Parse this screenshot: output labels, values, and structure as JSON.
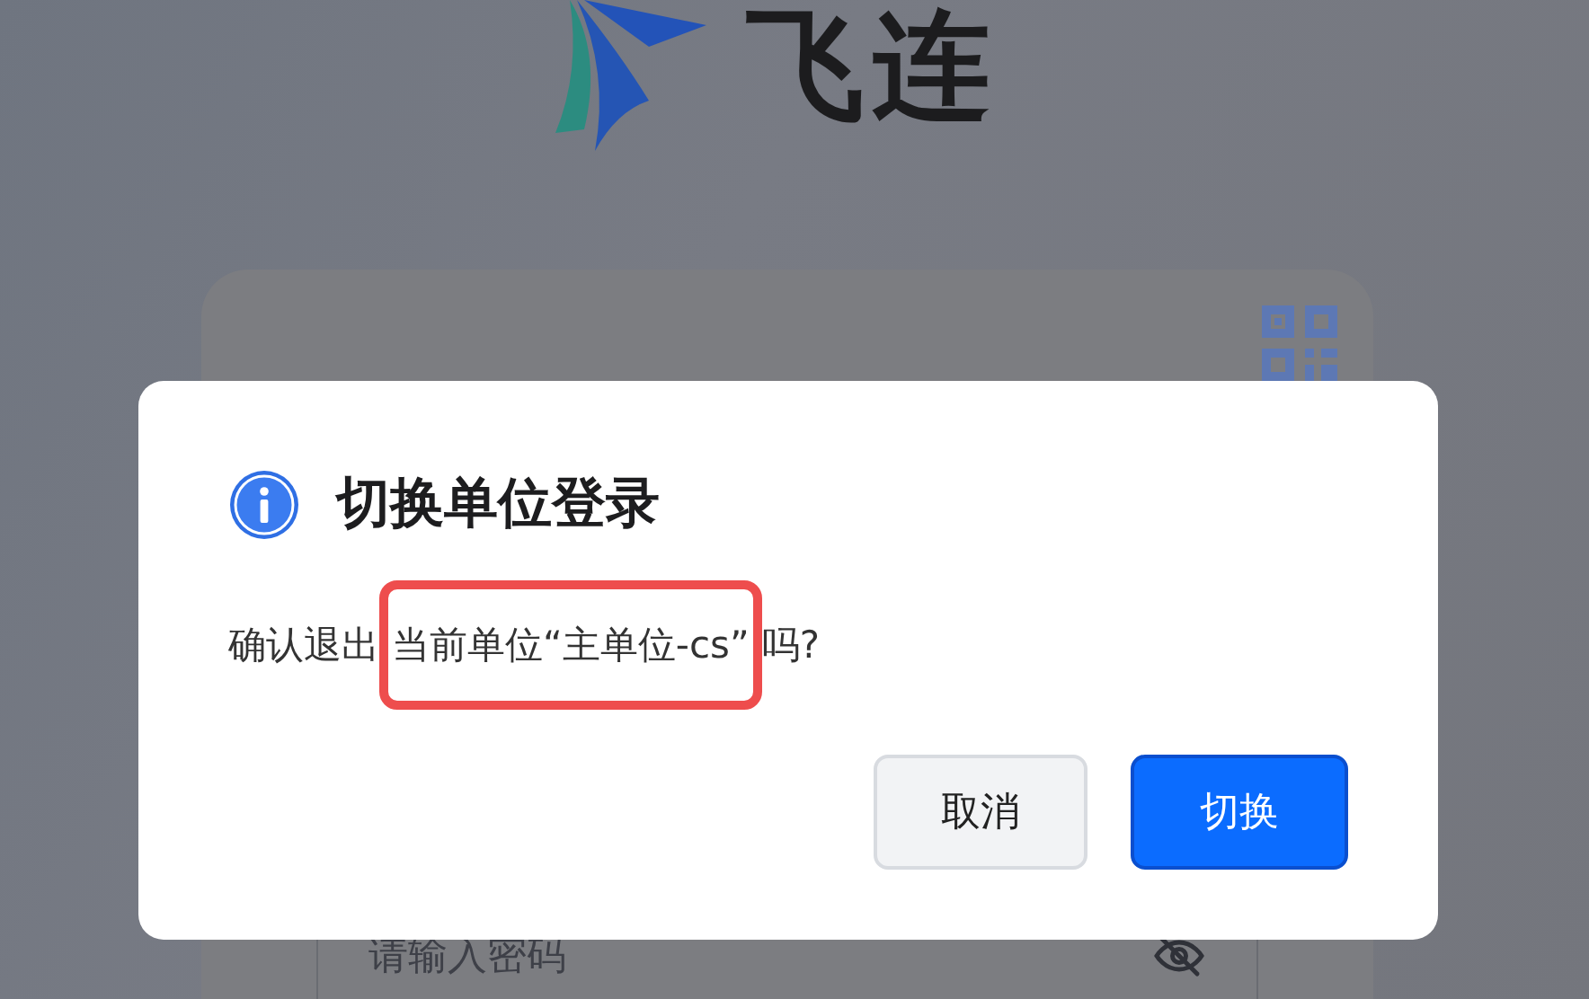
{
  "logo": {
    "text": "飞连"
  },
  "login_card": {
    "password_field": {
      "placeholder": "请输入密码",
      "visible": false
    }
  },
  "dialog": {
    "title": "切换单位登录",
    "message": {
      "before": "确认退出",
      "highlighted": "当前单位“主单位-cs”",
      "after": "吗?"
    },
    "buttons": [
      {
        "label": "取消",
        "kind": "secondary"
      },
      {
        "label": "切换",
        "kind": "primary"
      }
    ]
  }
}
